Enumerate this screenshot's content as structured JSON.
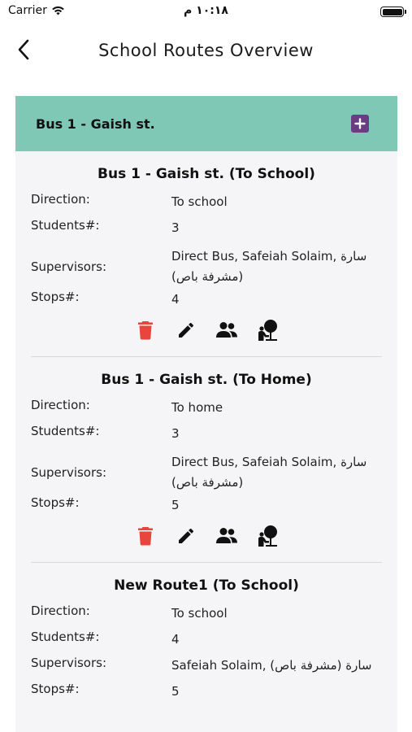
{
  "status_bar": {
    "carrier": "Carrier",
    "time": "١٠:١٨ م"
  },
  "nav": {
    "title": "School Routes Overview"
  },
  "group": {
    "title": "Bus 1 - Gaish st."
  },
  "labels": {
    "direction": "Direction:",
    "students": "Students#:",
    "supervisors": "Supervisors:",
    "stops": "Stops#:"
  },
  "routes": [
    {
      "title": "Bus 1 - Gaish st. (To School)",
      "direction": "To school",
      "students": "3",
      "supervisors_line1": "Direct Bus, Safeiah Solaim, سارة",
      "supervisors_line2": "(مشرفة باص)",
      "stops": "4"
    },
    {
      "title": "Bus 1 - Gaish st. (To Home)",
      "direction": "To home",
      "students": "3",
      "supervisors_line1": "Direct Bus, Safeiah Solaim, سارة",
      "supervisors_line2": "(مشرفة باص)",
      "stops": "5"
    },
    {
      "title": "New Route1 (To School)",
      "direction": "To school",
      "students": "4",
      "supervisors_line1": "Safeiah Solaim, سارة (مشرفة باص)",
      "stops": "5"
    }
  ],
  "icons": {
    "delete": "trash-icon",
    "edit": "pencil-icon",
    "students": "people-icon",
    "stops": "map-pin-person-icon"
  },
  "colors": {
    "header_bg": "#7ec8b5",
    "add_button": "#6b3c82",
    "delete": "#e8453c",
    "panel_bg": "#f5f5f7"
  }
}
